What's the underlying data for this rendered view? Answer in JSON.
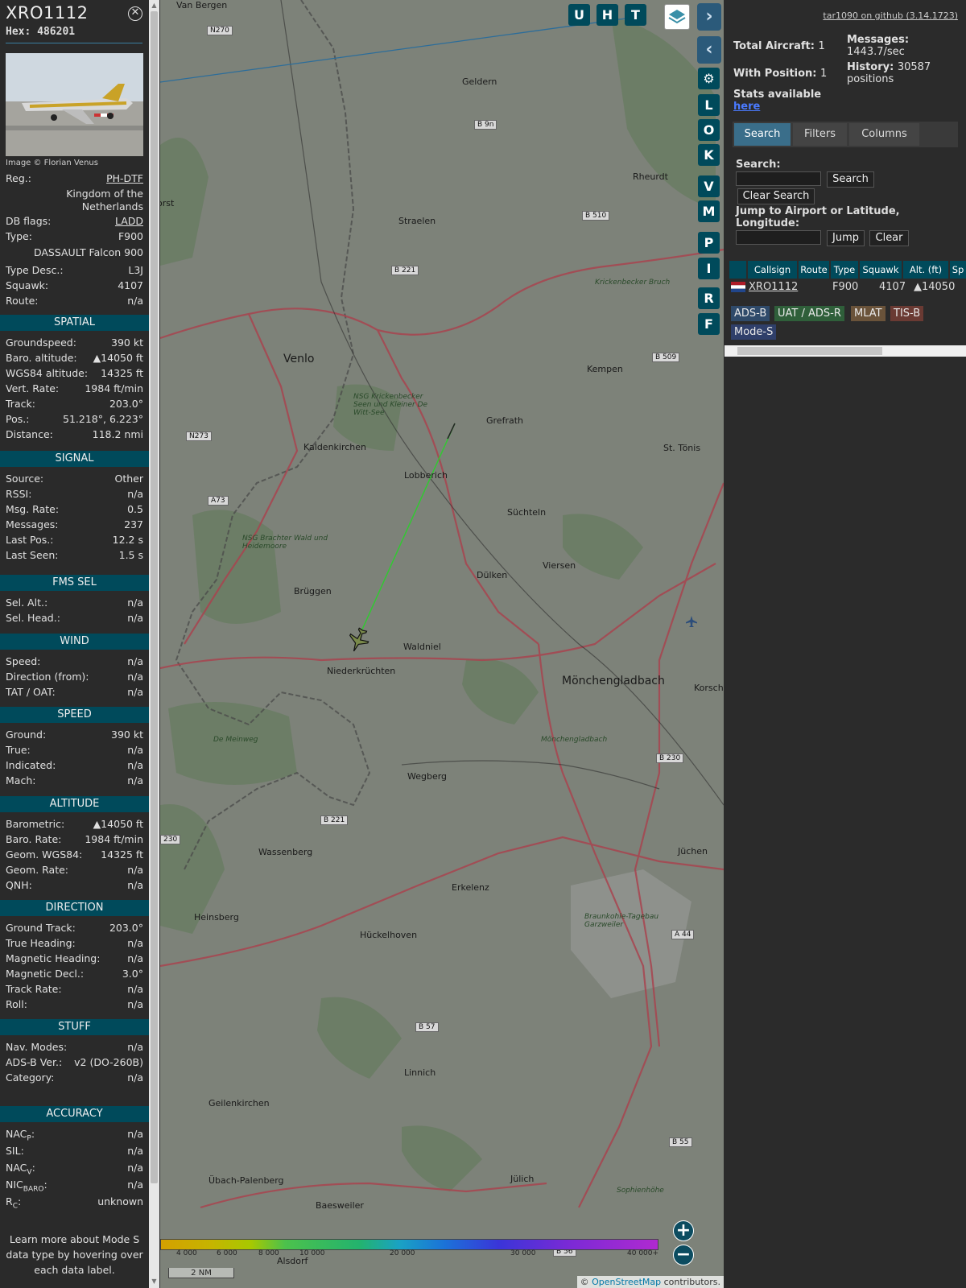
{
  "aircraft": {
    "callsign": "XRO1112",
    "hex": "Hex: 486201",
    "image_credit": "Image © Florian Venus",
    "reg_label": "Reg.:",
    "reg": "PH-DTF",
    "country_1": "Kingdom of the",
    "country_2": "Netherlands",
    "dbflags_label": "DB flags:",
    "dbflags": "LADD",
    "type_label": "Type:",
    "type": "F900",
    "model": "DASSAULT Falcon 900",
    "typedesc_label": "Type Desc.:",
    "typedesc": "L3J",
    "squawk_label": "Squawk:",
    "squawk": "4107",
    "route_label": "Route:",
    "route": "n/a"
  },
  "sections": [
    {
      "title": "SPATIAL",
      "rows": [
        {
          "k": "Groundspeed:",
          "v": "390 kt"
        },
        {
          "k": "Baro. altitude:",
          "v": "▲14050 ft"
        },
        {
          "k": "WGS84 altitude:",
          "v": "14325 ft"
        },
        {
          "k": "Vert. Rate:",
          "v": "1984 ft/min"
        },
        {
          "k": "Track:",
          "v": "203.0°"
        },
        {
          "k": "Pos.:",
          "v": "51.218°, 6.223°"
        },
        {
          "k": "Distance:",
          "v": "118.2 nmi"
        }
      ]
    },
    {
      "title": "SIGNAL",
      "rows": [
        {
          "k": "Source:",
          "v": "Other"
        },
        {
          "k": "RSSI:",
          "v": "n/a"
        },
        {
          "k": "Msg. Rate:",
          "v": "0.5"
        },
        {
          "k": "Messages:",
          "v": "237"
        },
        {
          "k": "Last Pos.:",
          "v": "12.2 s"
        },
        {
          "k": "Last Seen:",
          "v": "1.5 s"
        }
      ]
    },
    {
      "title": "FMS SEL",
      "rows": [
        {
          "k": "Sel. Alt.:",
          "v": "n/a"
        },
        {
          "k": "Sel. Head.:",
          "v": "n/a"
        }
      ]
    },
    {
      "title": "WIND",
      "rows": [
        {
          "k": "Speed:",
          "v": "n/a"
        },
        {
          "k": "Direction (from):",
          "v": "n/a"
        },
        {
          "k": "TAT / OAT:",
          "v": "n/a"
        }
      ]
    },
    {
      "title": "SPEED",
      "rows": [
        {
          "k": "Ground:",
          "v": "390 kt"
        },
        {
          "k": "True:",
          "v": "n/a"
        },
        {
          "k": "Indicated:",
          "v": "n/a"
        },
        {
          "k": "Mach:",
          "v": "n/a"
        }
      ]
    },
    {
      "title": "ALTITUDE",
      "rows": [
        {
          "k": "Barometric:",
          "v": "▲14050 ft"
        },
        {
          "k": "Baro. Rate:",
          "v": "1984 ft/min"
        },
        {
          "k": "Geom. WGS84:",
          "v": "14325 ft"
        },
        {
          "k": "Geom. Rate:",
          "v": "n/a"
        },
        {
          "k": "QNH:",
          "v": "n/a"
        }
      ]
    },
    {
      "title": "DIRECTION",
      "rows": [
        {
          "k": "Ground Track:",
          "v": "203.0°"
        },
        {
          "k": "True Heading:",
          "v": "n/a"
        },
        {
          "k": "Magnetic Heading:",
          "v": "n/a"
        },
        {
          "k": "Magnetic Decl.:",
          "v": "3.0°"
        },
        {
          "k": "Track Rate:",
          "v": "n/a"
        },
        {
          "k": "Roll:",
          "v": "n/a"
        }
      ]
    },
    {
      "title": "STUFF",
      "rows": [
        {
          "k": "Nav. Modes:",
          "v": "n/a"
        },
        {
          "k": "ADS-B Ver.:",
          "v": "v2 (DO-260B)"
        },
        {
          "k": "Category:",
          "v": "n/a"
        }
      ]
    },
    {
      "title": "ACCURACY",
      "rows": [
        {
          "k": "NAC",
          "sub": "P",
          "v": "n/a"
        },
        {
          "k": "SIL:",
          "v": "n/a"
        },
        {
          "k": "NAC",
          "sub": "V",
          "v": "n/a"
        },
        {
          "k": "NIC",
          "sub": "BARO",
          "v": "n/a"
        },
        {
          "k": "R",
          "sub": "C",
          "v": "unknown"
        }
      ]
    }
  ],
  "footer": {
    "line1": "Learn more about Mode S",
    "line2": "data type by hovering over",
    "line3": "each data label."
  },
  "map": {
    "top_buttons": [
      "U",
      "H",
      "T"
    ],
    "side_buttons": [
      "L",
      "O",
      "K",
      "V",
      "M",
      "P",
      "I",
      "R",
      "F"
    ],
    "scale": "2 NM",
    "attribution_prefix": "© ",
    "attribution_link": "OpenStreetMap",
    "attribution_suffix": " contributors.",
    "colorbar_ticks": [
      "4 000",
      "6 000",
      "8 000",
      "10 000",
      "20 000",
      "30 000",
      "40 000+"
    ],
    "places": [
      "Geldern",
      "Rheurdt",
      "Straelen",
      "Venlo",
      "Kempen",
      "Grefrath",
      "Kaldenkirchen",
      "Lobberich",
      "St. Tönis",
      "Süchteln",
      "Viersen",
      "Dülken",
      "Brüggen",
      "Waldniel",
      "Niederkrüchten",
      "Mönchengladbach",
      "Korschenbroich",
      "Wegberg",
      "Wassenberg",
      "Erkelenz",
      "Jüchen",
      "Heinsberg",
      "Hückelhoven",
      "Linnich",
      "Geilenkirchen",
      "Übach-Palenberg",
      "Baesweiler",
      "Jülich",
      "Alsdorf",
      "Van Bergen",
      "orst"
    ],
    "roads": [
      "N270",
      "B 9n",
      "B 510",
      "B 221",
      "B 509",
      "N273",
      "A73",
      "B 230",
      "B 221",
      "230",
      "A 44",
      "B 57",
      "B 55",
      "B 56"
    ],
    "areas": [
      "NSG Krickenbecker Seen und Kleiner De Witt-See",
      "NSG Brachter Wald und Heidemoore",
      "De Meinweg",
      "Braunkohle-Tagebau Garzweiler",
      "Sophienhöhe",
      "Krickenbecker Bruch",
      "Mönchengladbach"
    ],
    "track_color": "#3ad33a"
  },
  "panel": {
    "github": "tar1090 on github (3.14.1723)",
    "total_label": "Total Aircraft:",
    "total": "1",
    "withpos_label": "With Position:",
    "withpos": "1",
    "messages_label": "Messages:",
    "messages": "1443.7/sec",
    "history_label": "History:",
    "history_1": "30587",
    "history_2": "positions",
    "stats_label": "Stats available",
    "stats_link": "here",
    "tabs": [
      "Search",
      "Filters",
      "Columns"
    ],
    "search_label": "Search:",
    "search_button": "Search",
    "clear_search": "Clear Search",
    "jump_label_1": "Jump to Airport or Latitude,",
    "jump_label_2": "Longitude:",
    "jump_button": "Jump",
    "clear_button": "Clear",
    "columns": [
      "",
      "Callsign",
      "Route",
      "Type",
      "Squawk",
      "Alt. (ft)",
      "Sp"
    ],
    "row": {
      "callsign": "XRO1112",
      "route": "",
      "type": "F900",
      "squawk": "4107",
      "alt": "▲14050"
    },
    "sources": [
      "ADS-B",
      "UAT / ADS-R",
      "MLAT",
      "TIS-B",
      "Mode-S"
    ],
    "source_colors": [
      "#2f4a6a",
      "#2f5f3a",
      "#6a533a",
      "#6a3a33",
      "#2f3f6a"
    ]
  }
}
